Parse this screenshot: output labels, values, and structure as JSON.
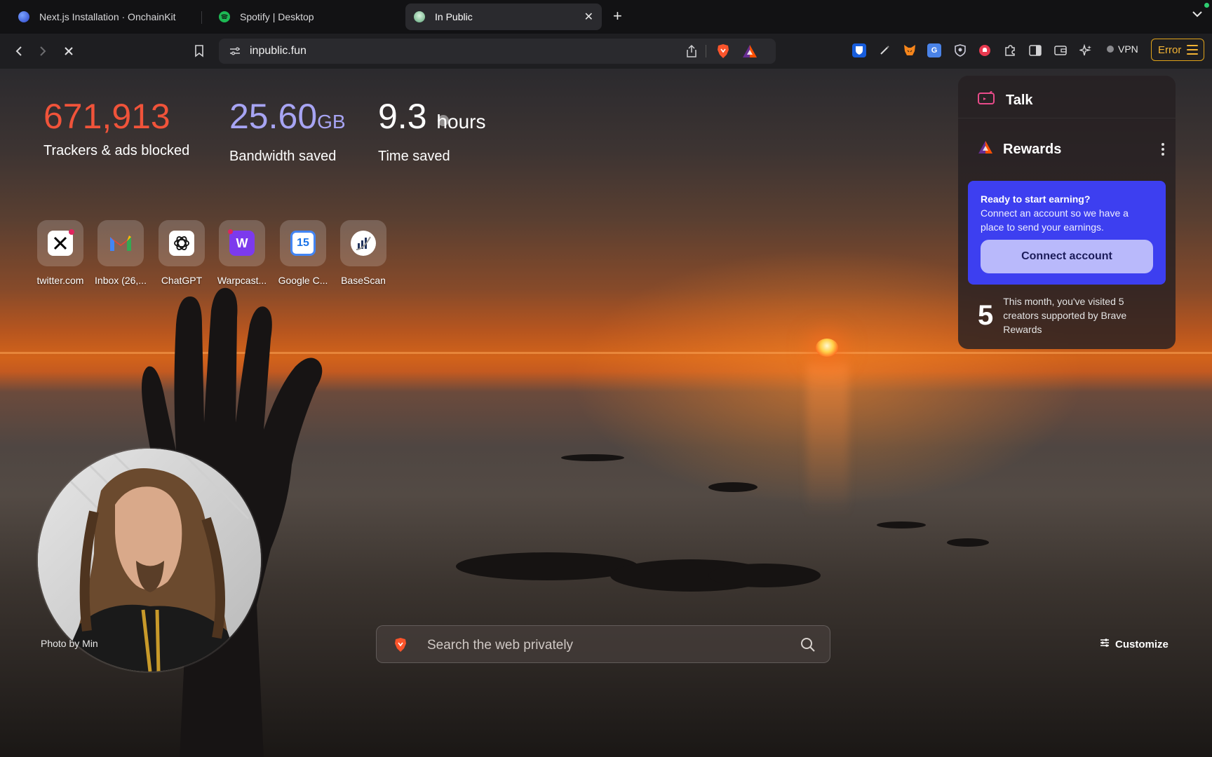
{
  "tabs": [
    {
      "title": "Next.js Installation · OnchainKit",
      "favicon_color": "#3b5bdb"
    },
    {
      "title": "Spotify | Desktop",
      "favicon_color": "#1db954"
    },
    {
      "title": "In Public",
      "favicon_color": "#9ad6a8"
    }
  ],
  "new_tab_label": "+",
  "address_bar": {
    "url": "inpublic.fun"
  },
  "toolbar": {
    "vpn_label": "VPN",
    "error_label": "Error"
  },
  "stats": {
    "trackers": {
      "value": "671,913",
      "label": "Trackers & ads blocked",
      "color": "#f0533a"
    },
    "bandwidth": {
      "value": "25.60",
      "unit": "GB",
      "label": "Bandwidth saved",
      "color": "#a7a4f3"
    },
    "time": {
      "value": "9.3",
      "unit": "hours",
      "label": "Time saved",
      "color": "#ffffff"
    }
  },
  "top_sites": [
    {
      "name": "twitter.com",
      "icon": "x-icon"
    },
    {
      "name": "Inbox (26,...",
      "icon": "gmail-icon"
    },
    {
      "name": "ChatGPT",
      "icon": "chatgpt-icon"
    },
    {
      "name": "Warpcast...",
      "icon": "warpcast-icon"
    },
    {
      "name": "Google C...",
      "icon": "google-calendar-icon",
      "badge": "15"
    },
    {
      "name": "BaseScan",
      "icon": "basescan-icon"
    }
  ],
  "card": {
    "talk_label": "Talk",
    "rewards_label": "Rewards",
    "earn_title": "Ready to start earning?",
    "earn_text": "Connect an account so we have a place to send your earnings.",
    "connect_label": "Connect account",
    "visits_count": "5",
    "visits_text": "This month, you've visited 5 creators supported by Brave Rewards"
  },
  "search": {
    "placeholder": "Search the web privately"
  },
  "photo_credit": "Photo by Min",
  "customize_label": "Customize",
  "colors": {
    "accent": "#3d3ff0",
    "error": "#f2b334"
  }
}
